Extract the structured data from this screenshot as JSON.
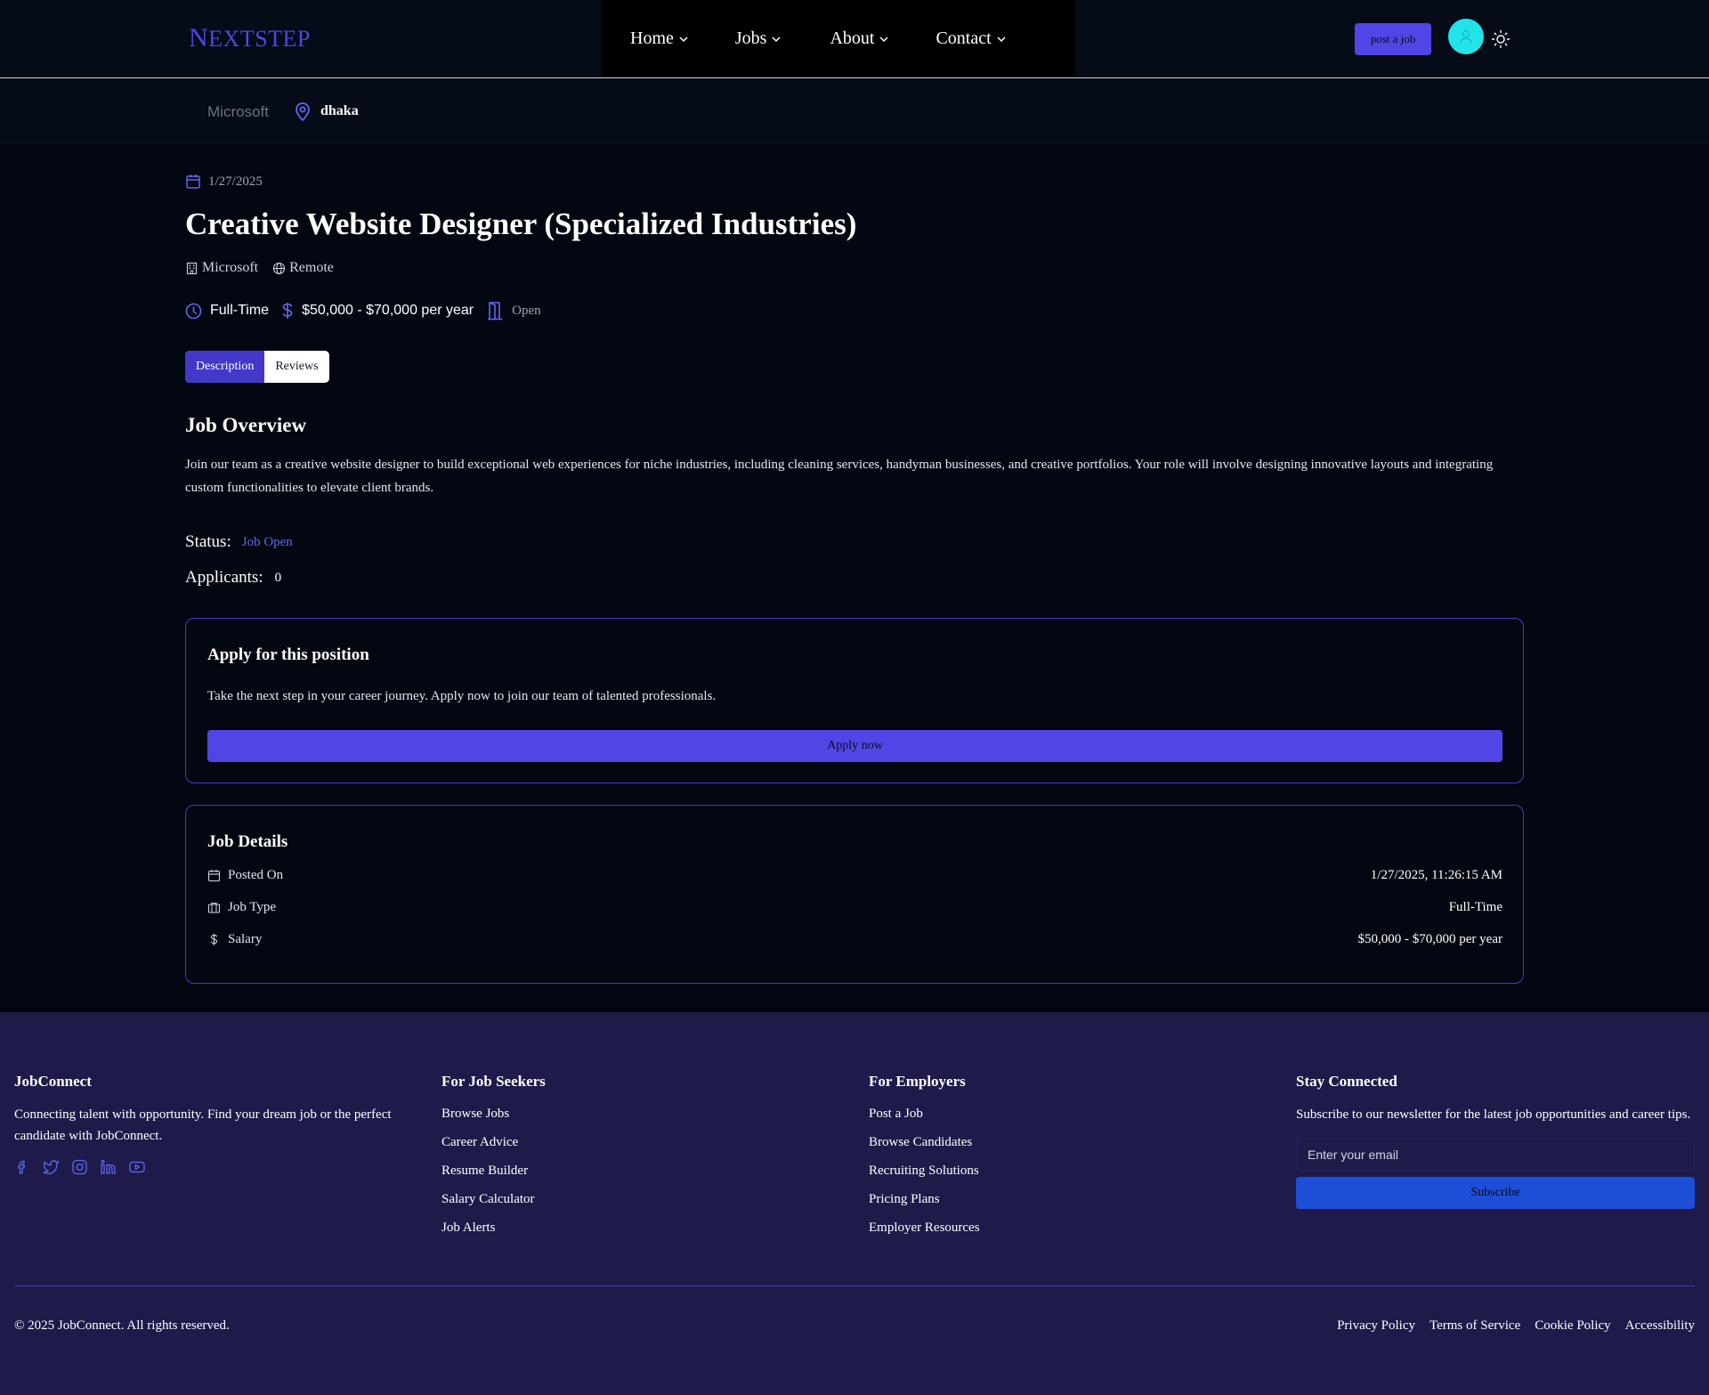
{
  "header": {
    "logo_first": "N",
    "logo_rest": "EXTSTEP",
    "nav": [
      {
        "label": "Home"
      },
      {
        "label": "Jobs"
      },
      {
        "label": "About"
      },
      {
        "label": "Contact"
      }
    ],
    "post_job_label": "post a job"
  },
  "subbar": {
    "company": "Microsoft",
    "location": "dhaka"
  },
  "job": {
    "date": "1/27/2025",
    "title": "Creative Website Designer (Specialized Industries)",
    "company": "Microsoft",
    "work_mode": "Remote",
    "job_type": "Full-Time",
    "salary": "$50,000 - $70,000 per year",
    "state": "Open",
    "tabs": [
      {
        "label": "Description"
      },
      {
        "label": "Reviews"
      }
    ],
    "overview_heading": "Job Overview",
    "overview_text": "Join our team as a creative website designer to build exceptional web experiences for niche industries, including cleaning services, handyman businesses, and creative portfolios. Your role will involve designing innovative layouts and integrating custom functionalities to elevate client brands.",
    "status_label": "Status:",
    "status_value": "Job Open",
    "applicants_label": "Applicants:",
    "applicants_value": "0"
  },
  "apply": {
    "title": "Apply for this position",
    "text": "Take the next step in your career journey. Apply now to join our team of talented professionals.",
    "button": "Apply now"
  },
  "details": {
    "title": "Job Details",
    "rows": [
      {
        "label": "Posted On",
        "value": "1/27/2025, 11:26:15 AM",
        "icon": "calendar-icon"
      },
      {
        "label": "Job Type",
        "value": "Full-Time",
        "icon": "briefcase-icon"
      },
      {
        "label": "Salary",
        "value": "$50,000 - $70,000 per year",
        "icon": "dollar-icon"
      }
    ]
  },
  "footer": {
    "brand": {
      "title": "JobConnect",
      "text": "Connecting talent with opportunity. Find your dream job or the perfect candidate with JobConnect."
    },
    "seekers": {
      "title": "For Job Seekers",
      "links": [
        "Browse Jobs",
        "Career Advice",
        "Resume Builder",
        "Salary Calculator",
        "Job Alerts"
      ]
    },
    "employers": {
      "title": "For Employers",
      "links": [
        "Post a Job",
        "Browse Candidates",
        "Recruiting Solutions",
        "Pricing Plans",
        "Employer Resources"
      ]
    },
    "newsletter": {
      "title": "Stay Connected",
      "text": "Subscribe to our newsletter for the latest job opportunities and career tips.",
      "placeholder": "Enter your email",
      "button": "Subscribe"
    },
    "copyright": "© 2025 JobConnect. All rights reserved.",
    "legal": [
      "Privacy Policy",
      "Terms of Service",
      "Cookie Policy",
      "Accessibility"
    ]
  },
  "colors": {
    "accent": "#4f46e5",
    "background": "#030712",
    "footer": "#1e1b4b",
    "avatar": "#22e4e8"
  }
}
